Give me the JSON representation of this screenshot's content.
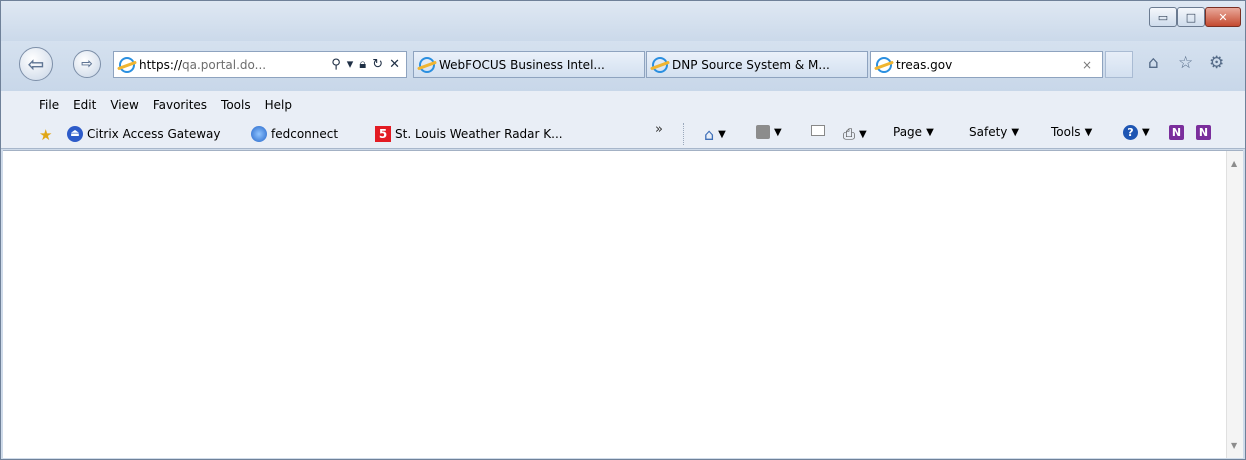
{
  "window": {
    "controls": {
      "minimize": "▭",
      "maximize": "□",
      "close": "✕"
    }
  },
  "nav": {
    "back_icon": "arrow-left-icon",
    "forward_icon": "arrow-right-icon",
    "address": {
      "protocol": "https://",
      "host_display": "qa.portal.do...",
      "icons": [
        "search-icon",
        "dropdown-icon",
        "lock-icon",
        "refresh-icon",
        "stop-icon"
      ]
    }
  },
  "tabs": [
    {
      "label": "WebFOCUS Business Intel...",
      "active": false
    },
    {
      "label": "DNP Source System & M...",
      "active": false
    },
    {
      "label": "treas.gov",
      "active": true,
      "close": "×"
    }
  ],
  "right_icons": [
    "home-icon",
    "star-icon",
    "gear-icon"
  ],
  "menu": {
    "items": [
      {
        "label": "File",
        "key": "F"
      },
      {
        "label": "Edit",
        "key": "E"
      },
      {
        "label": "View",
        "key": "V"
      },
      {
        "label": "Favorites",
        "key": "a"
      },
      {
        "label": "Tools",
        "key": "T"
      },
      {
        "label": "Help",
        "key": "H"
      }
    ]
  },
  "favorites": {
    "items": [
      {
        "label": "Citrix Access Gateway",
        "icon": "citrix-icon"
      },
      {
        "label": "fedconnect",
        "icon": "fedconnect-icon"
      },
      {
        "label": "St. Louis Weather Radar  K...",
        "icon": "ksdk-icon"
      }
    ],
    "overflow": "»"
  },
  "commandbar": {
    "page": "Page",
    "safety": "Safety",
    "tools": "Tools"
  },
  "colors": {
    "frame": "#cfdbea",
    "accent": "#2a8fe0"
  }
}
